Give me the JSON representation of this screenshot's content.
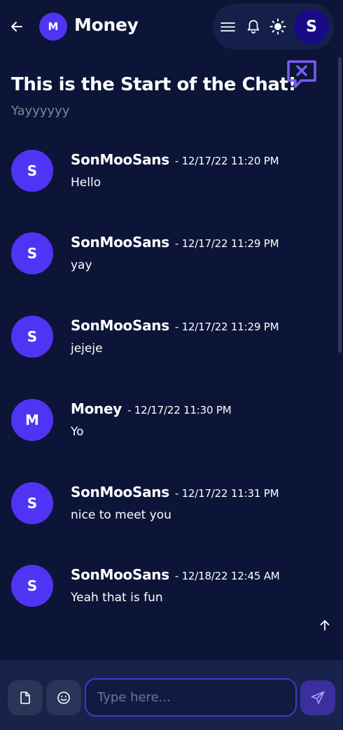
{
  "header": {
    "avatar_letter": "M",
    "title": "Money",
    "user_avatar_letter": "S"
  },
  "intro": {
    "title": "This is the Start of the Chat!",
    "subtitle": "Yayyyyyy"
  },
  "messages": [
    {
      "avatar": "S",
      "author": "SonMooSans",
      "time": "- 12/17/22 11:20 PM",
      "text": "Hello"
    },
    {
      "avatar": "S",
      "author": "SonMooSans",
      "time": "- 12/17/22 11:29 PM",
      "text": "yay"
    },
    {
      "avatar": "S",
      "author": "SonMooSans",
      "time": "- 12/17/22 11:29 PM",
      "text": "jejeje"
    },
    {
      "avatar": "M",
      "author": "Money",
      "time": "- 12/17/22 11:30 PM",
      "text": "Yo"
    },
    {
      "avatar": "S",
      "author": "SonMooSans",
      "time": "- 12/17/22 11:31 PM",
      "text": "nice to meet you"
    },
    {
      "avatar": "S",
      "author": "SonMooSans",
      "time": "- 12/18/22 12:45 AM",
      "text": "Yeah that is fun"
    }
  ],
  "composer": {
    "placeholder": "Type here..."
  },
  "icons": {
    "back": "arrow-left-icon",
    "menu": "hamburger-menu-icon",
    "notifications": "bell-icon",
    "theme": "sun-icon",
    "close_chat": "chat-close-icon",
    "scroll_top": "arrow-up-icon",
    "attach": "file-icon",
    "emoji": "smiley-icon",
    "send": "send-icon"
  },
  "colors": {
    "background": "#0c1537",
    "accent": "#4f35f3",
    "composer_bg": "#17234a",
    "close_icon": "#7b5cf0"
  }
}
